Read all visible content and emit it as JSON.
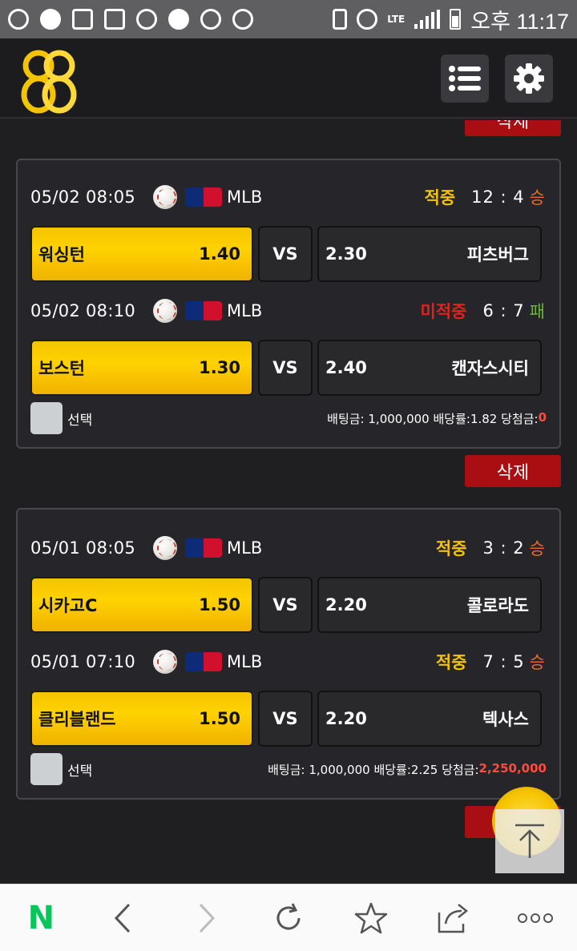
{
  "status_bar": {
    "time": "오후 11:17",
    "network": "LTE"
  },
  "app": {
    "logo": "88",
    "menu_icon": "list-icon",
    "settings_icon": "gear-icon"
  },
  "delete_label": "삭제",
  "top_partial_delete": "삭제",
  "bets": [
    {
      "games": [
        {
          "datetime": "05/02 08:05",
          "league": "MLB",
          "result": "적중",
          "result_type": "hit",
          "score": "12 : 4",
          "outcome": "승",
          "outcome_type": "win",
          "home": {
            "name": "워싱턴",
            "odds": "1.40"
          },
          "vs": "VS",
          "away": {
            "name": "피츠버그",
            "odds": "2.30"
          }
        },
        {
          "datetime": "05/02 08:10",
          "league": "MLB",
          "result": "미적중",
          "result_type": "miss",
          "score": "6 : 7",
          "outcome": "패",
          "outcome_type": "loss",
          "home": {
            "name": "보스턴",
            "odds": "1.30"
          },
          "vs": "VS",
          "away": {
            "name": "캔자스시티",
            "odds": "2.40"
          }
        }
      ],
      "select_label": "선택",
      "bet_info": "배팅금: 1,000,000 배당률:1.82 당첨금:",
      "payout": "0"
    },
    {
      "games": [
        {
          "datetime": "05/01 08:05",
          "league": "MLB",
          "result": "적중",
          "result_type": "hit",
          "score": "3 : 2",
          "outcome": "승",
          "outcome_type": "win",
          "home": {
            "name": "시카고C",
            "odds": "1.50"
          },
          "vs": "VS",
          "away": {
            "name": "콜로라도",
            "odds": "2.20"
          }
        },
        {
          "datetime": "05/01 07:10",
          "league": "MLB",
          "result": "적중",
          "result_type": "hit",
          "score": "7 : 5",
          "outcome": "승",
          "outcome_type": "win",
          "home": {
            "name": "클리블랜드",
            "odds": "1.50"
          },
          "vs": "VS",
          "away": {
            "name": "텍사스",
            "odds": "2.20"
          }
        }
      ],
      "select_label": "선택",
      "bet_info": "배팅금: 1,000,000 배당률:2.25 당첨금:",
      "payout": "2,250,000"
    }
  ],
  "browser_toolbar": {
    "items": [
      "naver-icon",
      "back-icon",
      "forward-icon",
      "refresh-icon",
      "bookmark-star-icon",
      "share-icon",
      "more-icon"
    ],
    "naver_label": "N"
  }
}
